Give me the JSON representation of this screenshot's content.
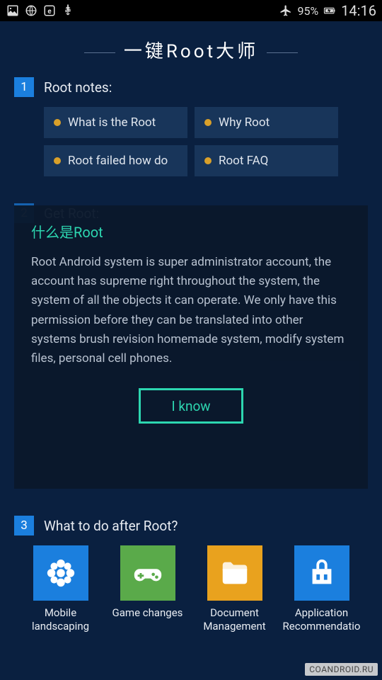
{
  "status": {
    "battery": "95%",
    "time": "14:16"
  },
  "app_title": "一键Root大师",
  "section1": {
    "num": "1",
    "title": "Root notes:"
  },
  "notes": [
    {
      "label": "What is the Root"
    },
    {
      "label": "Why Root"
    },
    {
      "label": "Root failed how do"
    },
    {
      "label": "Root FAQ"
    }
  ],
  "section2": {
    "num": "2",
    "title": "Get Root:"
  },
  "section3": {
    "num": "3",
    "title": "What to do after Root?"
  },
  "bottom": [
    {
      "label": "Mobile landscaping",
      "color": "#1b7fde"
    },
    {
      "label": "Game changes",
      "color": "#5aaa4a"
    },
    {
      "label": "Document Management",
      "color": "#e9a21e"
    },
    {
      "label": "Application Recommendatio",
      "color": "#1b7fde"
    }
  ],
  "modal": {
    "title": "什么是Root",
    "body": "Root Android system is super administrator account, the account has supreme right throughout the system, the system of all the objects it can operate. We only have this permission before they can be translated into other systems brush revision homemade system, modify system files, personal cell phones.",
    "button": "I know"
  },
  "watermark": "COANDROID.RU"
}
